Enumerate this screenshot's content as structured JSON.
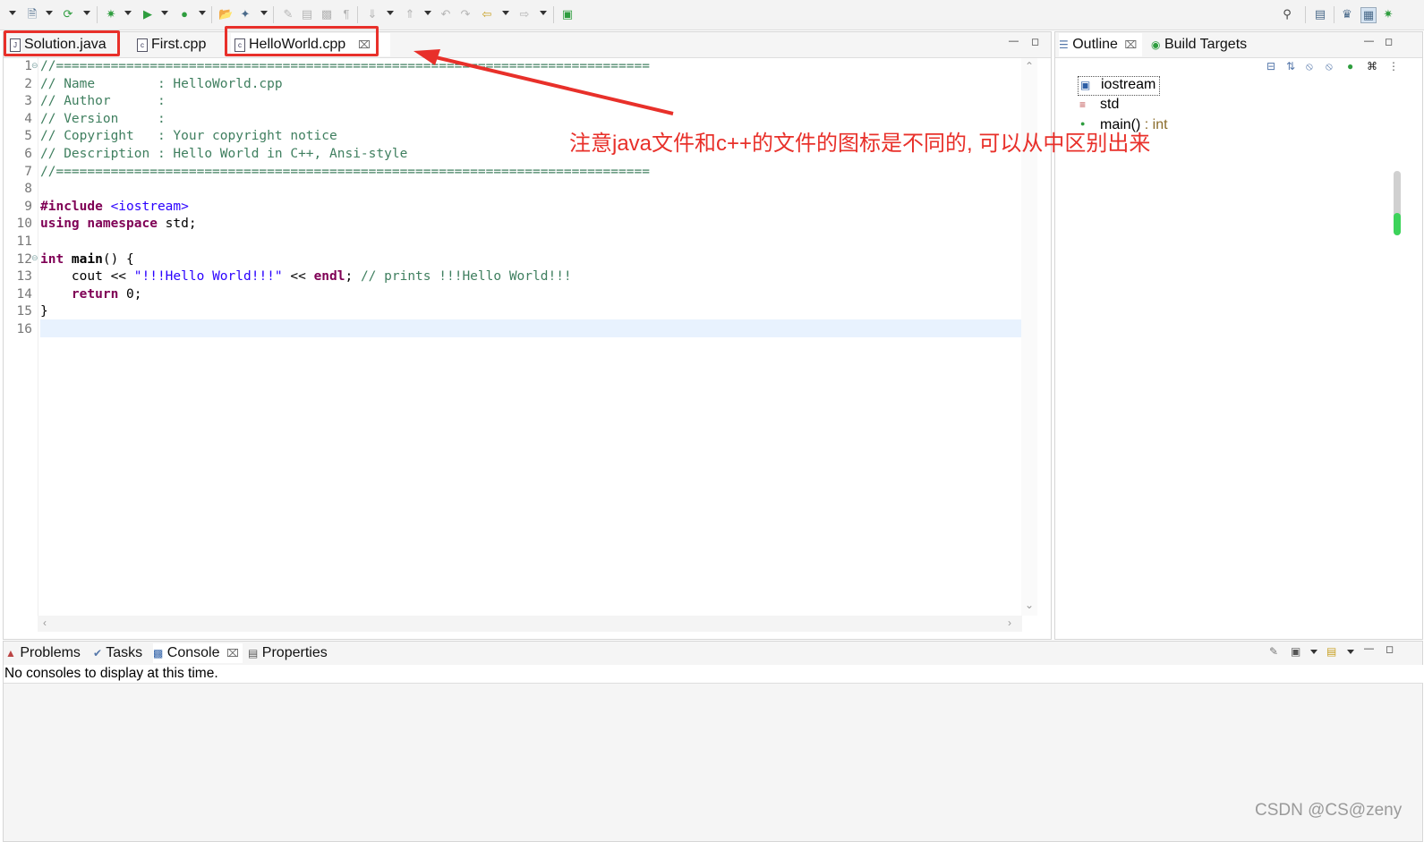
{
  "editor": {
    "tabs": [
      {
        "label": "Solution.java",
        "icon": "java-file-icon"
      },
      {
        "label": "First.cpp",
        "icon": "cpp-file-icon"
      },
      {
        "label": "HelloWorld.cpp",
        "icon": "cpp-file-icon",
        "active": true
      }
    ],
    "line_numbers": [
      "1",
      "2",
      "3",
      "4",
      "5",
      "6",
      "7",
      "8",
      "9",
      "10",
      "11",
      "12",
      "13",
      "14",
      "15",
      "16"
    ],
    "code": {
      "l1": "//============================================================================",
      "l2": "// Name        : HelloWorld.cpp",
      "l3": "// Author      :",
      "l4": "// Version     :",
      "l5": "// Copyright   : Your copyright notice",
      "l6": "// Description : Hello World in C++, Ansi-style",
      "l7": "//============================================================================",
      "l9_kw": "#include",
      "l9_str": " <iostream>",
      "l10_kw": "using namespace",
      "l10_rest": " std;",
      "l12_kw": "int",
      "l12_fn": " main",
      "l12_rest": "() {",
      "l13_indent": "    cout << ",
      "l13_str": "\"!!!Hello World!!!\"",
      "l13_mid": " << ",
      "l13_endl": "endl",
      "l13_semi": "; ",
      "l13_cmt": "// prints !!!Hello World!!!",
      "l14_indent": "    ",
      "l14_kw": "return",
      "l14_rest": " 0;",
      "l15": "}"
    }
  },
  "outline": {
    "tabs": [
      {
        "label": "Outline",
        "icon": "outline-icon"
      },
      {
        "label": "Build Targets",
        "icon": "build-targets-icon"
      }
    ],
    "items": [
      {
        "label": "iostream",
        "icon": "include-icon"
      },
      {
        "label": "std",
        "icon": "namespace-icon"
      },
      {
        "label": "main()",
        "suffix": " : int",
        "icon": "function-icon"
      }
    ]
  },
  "bottom": {
    "tabs": [
      {
        "label": "Problems",
        "icon": "problems-icon"
      },
      {
        "label": "Tasks",
        "icon": "tasks-icon"
      },
      {
        "label": "Console",
        "icon": "console-icon"
      },
      {
        "label": "Properties",
        "icon": "properties-icon"
      }
    ],
    "console_message": "No consoles to display at this time."
  },
  "annotation": {
    "text": "注意java文件和c++的文件的图标是不同的, 可以从中区别出来",
    "color": "#e8302a"
  },
  "watermark": "CSDN @CS@zeny"
}
